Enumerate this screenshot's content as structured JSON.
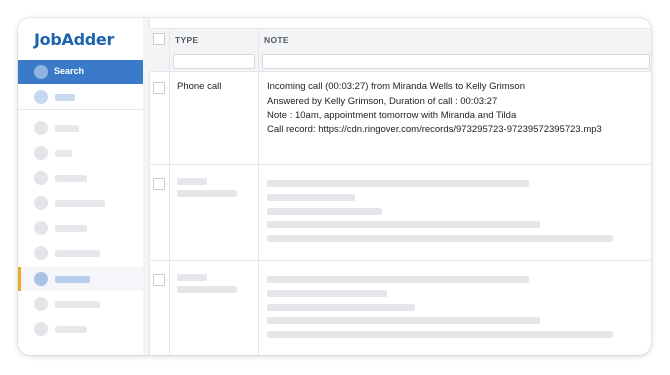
{
  "app": {
    "logo": "JobAdder"
  },
  "sidebar": {
    "search_label": "Search"
  },
  "table": {
    "columns": [
      "TYPE",
      "NOTE"
    ],
    "rows": [
      {
        "type": "Phone call",
        "note_lines": [
          "Incoming call (00:03:27) from Miranda Wells to Kelly Grimson",
          "Answered by Kelly Grimson, Duration of call : 00:03:27",
          "Note : 10am, appointment tomorrow with Miranda and Tilda",
          "Call record: https://cdn.ringover.com/records/973295723-97239572395723.mp3"
        ]
      }
    ]
  },
  "colors": {
    "brand": "#1e63ad",
    "active_nav": "#3a7ac8",
    "selected_marker": "#f0a929"
  }
}
